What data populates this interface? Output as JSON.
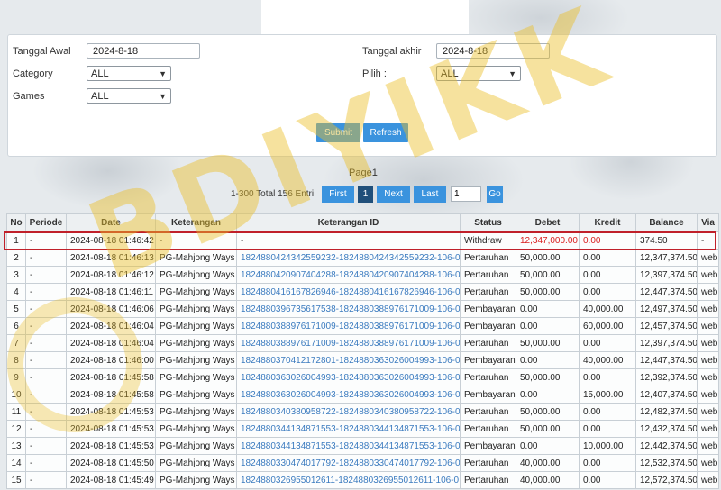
{
  "filters": {
    "tanggal_awal_label": "Tanggal Awal",
    "tanggal_awal_value": "2024-8-18",
    "tanggal_akhir_label": "Tanggal akhir",
    "tanggal_akhir_value": "2024-8-18",
    "category_label": "Category",
    "category_value": "ALL",
    "pilih_label": "Pilih  :",
    "pilih_value": "ALL",
    "games_label": "Games",
    "games_value": "ALL",
    "submit_label": "Submit",
    "refresh_label": "Refresh"
  },
  "pager": {
    "title": "Page1",
    "total": "1-300 Total 156 Entri",
    "first": "First",
    "current": "1",
    "next": "Next",
    "last": "Last",
    "input_value": "1",
    "go": "Go"
  },
  "table": {
    "headers": [
      "No",
      "Periode",
      "Date",
      "Keterangan",
      "Keterangan ID",
      "Status",
      "Debet",
      "Kredit",
      "Balance",
      "Via"
    ],
    "rows": [
      [
        "1",
        "-",
        "2024-08-18 01:46:42",
        "-",
        "-",
        "Withdraw",
        "12,347,000.00",
        "0.00",
        "374.50",
        "-"
      ],
      [
        "2",
        "-",
        "2024-08-18 01:46:13",
        "PG-Mahjong Ways",
        "1824880424342559232-1824880424342559232-106-0",
        "Pertaruhan",
        "50,000.00",
        "0.00",
        "12,347,374.50",
        "web"
      ],
      [
        "3",
        "-",
        "2024-08-18 01:46:12",
        "PG-Mahjong Ways",
        "1824880420907404288-1824880420907404288-106-0",
        "Pertaruhan",
        "50,000.00",
        "0.00",
        "12,397,374.50",
        "web"
      ],
      [
        "4",
        "-",
        "2024-08-18 01:46:11",
        "PG-Mahjong Ways",
        "1824880416167826946-1824880416167826946-106-0",
        "Pertaruhan",
        "50,000.00",
        "0.00",
        "12,447,374.50",
        "web"
      ],
      [
        "5",
        "-",
        "2024-08-18 01:46:06",
        "PG-Mahjong Ways",
        "1824880396735617538-1824880388976171009-106-0",
        "Pembayaran",
        "0.00",
        "40,000.00",
        "12,497,374.50",
        "web"
      ],
      [
        "6",
        "-",
        "2024-08-18 01:46:04",
        "PG-Mahjong Ways",
        "1824880388976171009-1824880388976171009-106-0",
        "Pembayaran",
        "0.00",
        "60,000.00",
        "12,457,374.50",
        "web"
      ],
      [
        "7",
        "-",
        "2024-08-18 01:46:04",
        "PG-Mahjong Ways",
        "1824880388976171009-1824880388976171009-106-0",
        "Pertaruhan",
        "50,000.00",
        "0.00",
        "12,397,374.50",
        "web"
      ],
      [
        "8",
        "-",
        "2024-08-18 01:46:00",
        "PG-Mahjong Ways",
        "1824880370412172801-1824880363026004993-106-0",
        "Pembayaran",
        "0.00",
        "40,000.00",
        "12,447,374.50",
        "web"
      ],
      [
        "9",
        "-",
        "2024-08-18 01:45:58",
        "PG-Mahjong Ways",
        "1824880363026004993-1824880363026004993-106-0",
        "Pertaruhan",
        "50,000.00",
        "0.00",
        "12,392,374.50",
        "web"
      ],
      [
        "10",
        "-",
        "2024-08-18 01:45:58",
        "PG-Mahjong Ways",
        "1824880363026004993-1824880363026004993-106-0",
        "Pembayaran",
        "0.00",
        "15,000.00",
        "12,407,374.50",
        "web"
      ],
      [
        "11",
        "-",
        "2024-08-18 01:45:53",
        "PG-Mahjong Ways",
        "1824880340380958722-1824880340380958722-106-0",
        "Pertaruhan",
        "50,000.00",
        "0.00",
        "12,482,374.50",
        "web"
      ],
      [
        "12",
        "-",
        "2024-08-18 01:45:53",
        "PG-Mahjong Ways",
        "1824880344134871553-1824880344134871553-106-0",
        "Pertaruhan",
        "50,000.00",
        "0.00",
        "12,432,374.50",
        "web"
      ],
      [
        "13",
        "-",
        "2024-08-18 01:45:53",
        "PG-Mahjong Ways",
        "1824880344134871553-1824880344134871553-106-0",
        "Pembayaran",
        "0.00",
        "10,000.00",
        "12,442,374.50",
        "web"
      ],
      [
        "14",
        "-",
        "2024-08-18 01:45:50",
        "PG-Mahjong Ways",
        "1824880330474017792-1824880330474017792-106-0",
        "Pertaruhan",
        "40,000.00",
        "0.00",
        "12,532,374.50",
        "web"
      ],
      [
        "15",
        "-",
        "2024-08-18 01:45:49",
        "PG-Mahjong Ways",
        "1824880326955012611-1824880326955012611-106-0",
        "Pertaruhan",
        "40,000.00",
        "0.00",
        "12,572,374.50",
        "web"
      ]
    ]
  },
  "watermark": "BDIYIKK",
  "colors": {
    "accent": "#3a93de",
    "highlight": "#c0202a",
    "link": "#3b7bbf"
  }
}
